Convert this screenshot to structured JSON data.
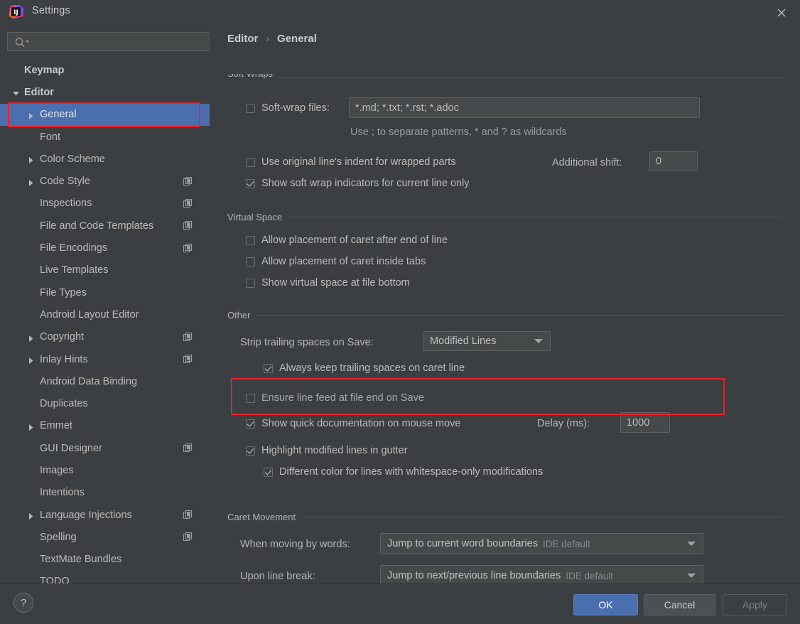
{
  "window": {
    "title": "Settings",
    "app_icon": "intellij-idea-icon",
    "close_icon": "close-icon"
  },
  "sidebar": {
    "search": {
      "value": "",
      "placeholder": "",
      "icon": "search-icon"
    },
    "items": [
      {
        "label": "Keymap",
        "level": 0,
        "arrow": "none",
        "bold": true,
        "badge": false,
        "selected": false
      },
      {
        "label": "Editor",
        "level": 0,
        "arrow": "expanded",
        "bold": true,
        "badge": false,
        "selected": false
      },
      {
        "label": "General",
        "level": 1,
        "arrow": "collapsed",
        "bold": false,
        "badge": false,
        "selected": true
      },
      {
        "label": "Font",
        "level": 1,
        "arrow": "none",
        "bold": false,
        "badge": false,
        "selected": false
      },
      {
        "label": "Color Scheme",
        "level": 1,
        "arrow": "collapsed",
        "bold": false,
        "badge": false,
        "selected": false
      },
      {
        "label": "Code Style",
        "level": 1,
        "arrow": "collapsed",
        "bold": false,
        "badge": true,
        "selected": false
      },
      {
        "label": "Inspections",
        "level": 1,
        "arrow": "none",
        "bold": false,
        "badge": true,
        "selected": false
      },
      {
        "label": "File and Code Templates",
        "level": 1,
        "arrow": "none",
        "bold": false,
        "badge": true,
        "selected": false
      },
      {
        "label": "File Encodings",
        "level": 1,
        "arrow": "none",
        "bold": false,
        "badge": true,
        "selected": false
      },
      {
        "label": "Live Templates",
        "level": 1,
        "arrow": "none",
        "bold": false,
        "badge": false,
        "selected": false
      },
      {
        "label": "File Types",
        "level": 1,
        "arrow": "none",
        "bold": false,
        "badge": false,
        "selected": false
      },
      {
        "label": "Android Layout Editor",
        "level": 1,
        "arrow": "none",
        "bold": false,
        "badge": false,
        "selected": false
      },
      {
        "label": "Copyright",
        "level": 1,
        "arrow": "collapsed",
        "bold": false,
        "badge": true,
        "selected": false
      },
      {
        "label": "Inlay Hints",
        "level": 1,
        "arrow": "collapsed",
        "bold": false,
        "badge": true,
        "selected": false
      },
      {
        "label": "Android Data Binding",
        "level": 1,
        "arrow": "none",
        "bold": false,
        "badge": false,
        "selected": false
      },
      {
        "label": "Duplicates",
        "level": 1,
        "arrow": "none",
        "bold": false,
        "badge": false,
        "selected": false
      },
      {
        "label": "Emmet",
        "level": 1,
        "arrow": "collapsed",
        "bold": false,
        "badge": false,
        "selected": false
      },
      {
        "label": "GUI Designer",
        "level": 1,
        "arrow": "none",
        "bold": false,
        "badge": true,
        "selected": false
      },
      {
        "label": "Images",
        "level": 1,
        "arrow": "none",
        "bold": false,
        "badge": false,
        "selected": false
      },
      {
        "label": "Intentions",
        "level": 1,
        "arrow": "none",
        "bold": false,
        "badge": false,
        "selected": false
      },
      {
        "label": "Language Injections",
        "level": 1,
        "arrow": "collapsed",
        "bold": false,
        "badge": true,
        "selected": false
      },
      {
        "label": "Spelling",
        "level": 1,
        "arrow": "none",
        "bold": false,
        "badge": true,
        "selected": false
      },
      {
        "label": "TextMate Bundles",
        "level": 1,
        "arrow": "none",
        "bold": false,
        "badge": false,
        "selected": false
      },
      {
        "label": "TODO",
        "level": 1,
        "arrow": "none",
        "bold": false,
        "badge": false,
        "selected": false
      }
    ]
  },
  "breadcrumb": {
    "root": "Editor",
    "separator": "›",
    "leaf": "General"
  },
  "sections": {
    "soft_wraps": {
      "title": "Soft Wraps",
      "soft_wrap_files": {
        "label": "Soft-wrap files:",
        "checked": false,
        "value": "*.md; *.txt; *.rst; *.adoc"
      },
      "hint": "Use ; to separate patterns, * and ? as wildcards",
      "use_original_indent": {
        "label": "Use original line's indent for wrapped parts",
        "checked": false
      },
      "additional_shift": {
        "label": "Additional shift:",
        "value": "0"
      },
      "show_indicators": {
        "label": "Show soft wrap indicators for current line only",
        "checked": true
      }
    },
    "virtual_space": {
      "title": "Virtual Space",
      "items": [
        {
          "label": "Allow placement of caret after end of line",
          "checked": false
        },
        {
          "label": "Allow placement of caret inside tabs",
          "checked": false
        },
        {
          "label": "Show virtual space at file bottom",
          "checked": false
        }
      ]
    },
    "other": {
      "title": "Other",
      "strip_trailing": {
        "label": "Strip trailing spaces on Save:",
        "value": "Modified Lines"
      },
      "always_keep": {
        "label": "Always keep trailing spaces on caret line",
        "checked": true
      },
      "ensure_line_feed": {
        "label": "Ensure line feed at file end on Save",
        "checked": false
      },
      "quick_doc": {
        "label": "Show quick documentation on mouse move",
        "checked": true
      },
      "delay": {
        "label": "Delay (ms):",
        "value": "1000"
      },
      "highlight_modified": {
        "label": "Highlight modified lines in gutter",
        "checked": true
      },
      "different_color": {
        "label": "Different color for lines with whitespace-only modifications",
        "checked": true
      }
    },
    "caret_movement": {
      "title": "Caret Movement",
      "when_moving_by_words": {
        "label": "When moving by words:",
        "value": "Jump to current word boundaries",
        "suffix": "IDE default"
      },
      "upon_line_break": {
        "label": "Upon line break:",
        "value": "Jump to next/previous line boundaries",
        "suffix": "IDE default"
      }
    }
  },
  "footer": {
    "help": "?",
    "ok": "OK",
    "cancel": "Cancel",
    "apply": "Apply"
  },
  "annotations": {
    "accent_blue": "#4b6eaf",
    "highlight_red": "#e8222a",
    "background": "#3c3f41"
  }
}
